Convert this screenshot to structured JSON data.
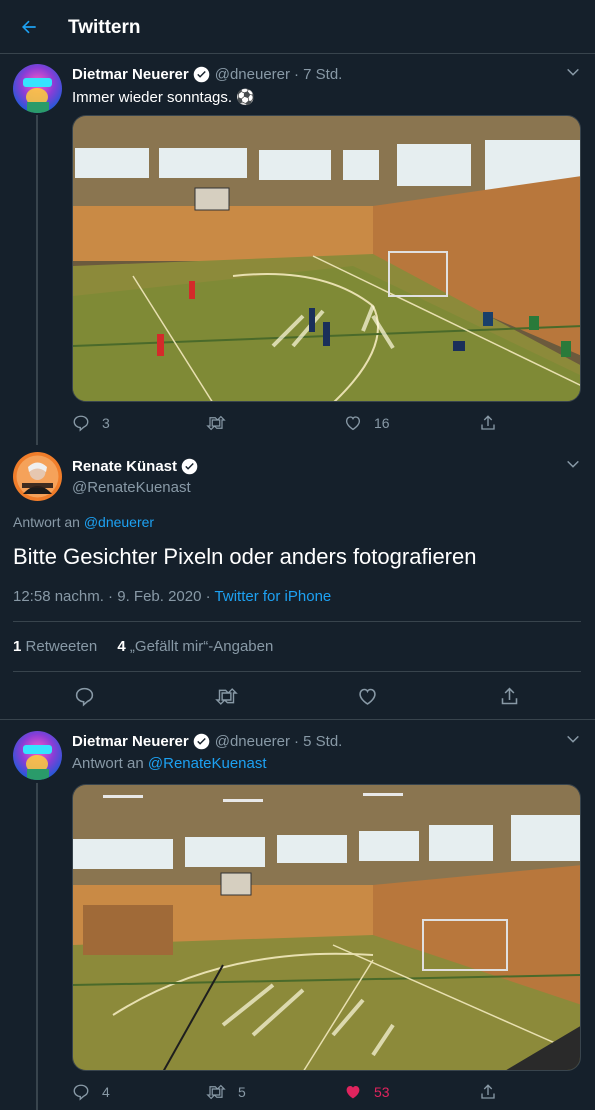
{
  "header": {
    "title": "Twittern",
    "back_icon": "back-arrow-icon"
  },
  "colors": {
    "background": "#15202b",
    "accent": "#1da1f2",
    "muted": "#8899a6",
    "like": "#e0245e",
    "border": "#38444d"
  },
  "tweet1": {
    "name": "Dietmar Neuerer",
    "handle": "@dneuerer",
    "time": "· 7 Std.",
    "text": "Immer wieder sonntags. ⚽",
    "replies": "3",
    "retweets": "",
    "likes": "16"
  },
  "main_tweet": {
    "name": "Renate Künast",
    "handle": "@RenateKuenast",
    "reply_prefix": "Antwort an",
    "reply_to": "@dneuerer",
    "text": "Bitte Gesichter Pixeln oder anders fotografieren",
    "timestamp": "12:58 nachm. · 9. Feb. 2020 ·",
    "source": "Twitter for iPhone",
    "retweet_count": "1",
    "retweet_label": "Retweeten",
    "like_count": "4",
    "like_label": "„Gefällt mir“-Angaben"
  },
  "tweet3": {
    "name": "Dietmar Neuerer",
    "handle": "@dneuerer",
    "time": "· 5 Std.",
    "reply_prefix": "Antwort an",
    "reply_to": "@RenateKuenast",
    "replies": "4",
    "retweets": "5",
    "likes": "53"
  }
}
